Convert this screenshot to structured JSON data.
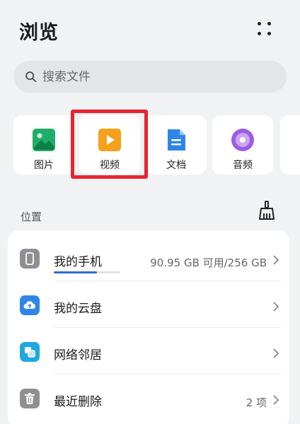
{
  "header": {
    "title": "浏览"
  },
  "search": {
    "placeholder": "搜索文件"
  },
  "categories": [
    {
      "label": "图片",
      "icon": "image-icon",
      "color": "#1fae6a"
    },
    {
      "label": "视频",
      "icon": "video-icon",
      "color": "#f5a11b"
    },
    {
      "label": "文档",
      "icon": "document-icon",
      "color": "#2f86e8"
    },
    {
      "label": "音频",
      "icon": "audio-icon",
      "color": "#9b5de5"
    }
  ],
  "location": {
    "section_label": "位置",
    "items": [
      {
        "label": "我的手机",
        "meta": "90.95 GB 可用/256 GB",
        "icon": "phone-icon",
        "icon_color": "#8e8e93",
        "usage_fraction": 0.645
      },
      {
        "label": "我的云盘",
        "meta": "",
        "icon": "cloud-icon",
        "icon_color": "#2f86e8"
      },
      {
        "label": "网络邻居",
        "meta": "",
        "icon": "network-icon",
        "icon_color": "#1ea7e0"
      },
      {
        "label": "最近删除",
        "meta": "2 项",
        "icon": "trash-icon",
        "icon_color": "#8e8e93"
      }
    ]
  },
  "highlight_color": "#e8252f"
}
